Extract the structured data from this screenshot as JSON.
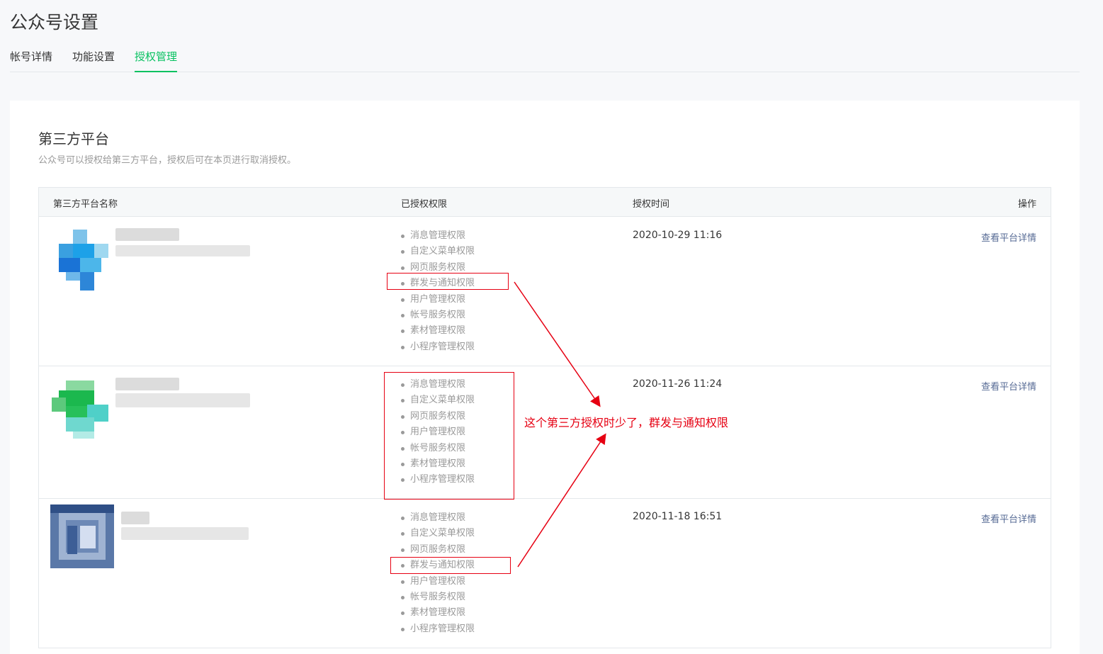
{
  "page": {
    "title": "公众号设置"
  },
  "tabs": [
    {
      "label": "帐号详情",
      "active": false
    },
    {
      "label": "功能设置",
      "active": false
    },
    {
      "label": "授权管理",
      "active": true
    }
  ],
  "section": {
    "title": "第三方平台",
    "description": "公众号可以授权给第三方平台，授权后可在本页进行取消授权。"
  },
  "table": {
    "headers": {
      "name": "第三方平台名称",
      "permissions": "已授权权限",
      "time": "授权时间",
      "action": "操作"
    },
    "rows": [
      {
        "permissions": [
          "消息管理权限",
          "自定义菜单权限",
          "网页服务权限",
          "群发与通知权限",
          "用户管理权限",
          "帐号服务权限",
          "素材管理权限",
          "小程序管理权限"
        ],
        "time": "2020-10-29 11:16",
        "action": "查看平台详情"
      },
      {
        "permissions": [
          "消息管理权限",
          "自定义菜单权限",
          "网页服务权限",
          "用户管理权限",
          "帐号服务权限",
          "素材管理权限",
          "小程序管理权限"
        ],
        "time": "2020-11-26 11:24",
        "action": "查看平台详情"
      },
      {
        "permissions": [
          "消息管理权限",
          "自定义菜单权限",
          "网页服务权限",
          "群发与通知权限",
          "用户管理权限",
          "帐号服务权限",
          "素材管理权限",
          "小程序管理权限"
        ],
        "time": "2020-11-18 16:51",
        "action": "查看平台详情"
      }
    ]
  },
  "annotation": {
    "text": "这个第三方授权时少了，群发与通知权限"
  },
  "colors": {
    "accent": "#07c160",
    "link": "#576b95",
    "annotation": "#e60012"
  },
  "icons": [
    "platform-logo-blue",
    "platform-logo-green",
    "platform-logo-navy"
  ]
}
